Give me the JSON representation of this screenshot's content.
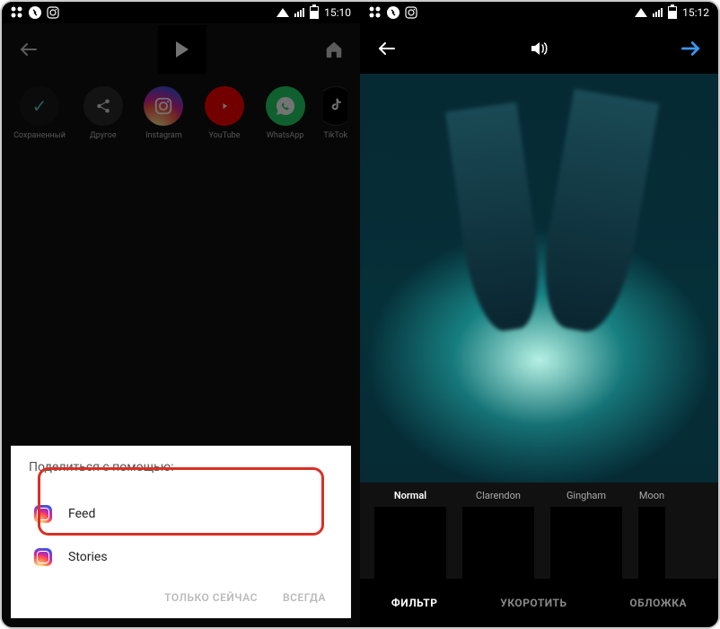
{
  "status_left": {
    "time": "15:10"
  },
  "status_right": {
    "time": "15:12"
  },
  "share_targets": [
    {
      "label": "Сохраненный"
    },
    {
      "label": "Другое"
    },
    {
      "label": "Instagram"
    },
    {
      "label": "YouTube"
    },
    {
      "label": "WhatsApp"
    },
    {
      "label": "TikTok"
    }
  ],
  "sheet": {
    "title": "Поделиться с помощью:",
    "feed": "Feed",
    "stories": "Stories",
    "just_once": "ТОЛЬКО СЕЙЧАС",
    "always": "ВСЕГДА"
  },
  "filters": [
    {
      "name": "Normal"
    },
    {
      "name": "Clarendon"
    },
    {
      "name": "Gingham"
    },
    {
      "name": "Moon"
    }
  ],
  "tabs": {
    "filter": "ФИЛЬТР",
    "trim": "УКОРОТИТЬ",
    "cover": "ОБЛОЖКА"
  }
}
